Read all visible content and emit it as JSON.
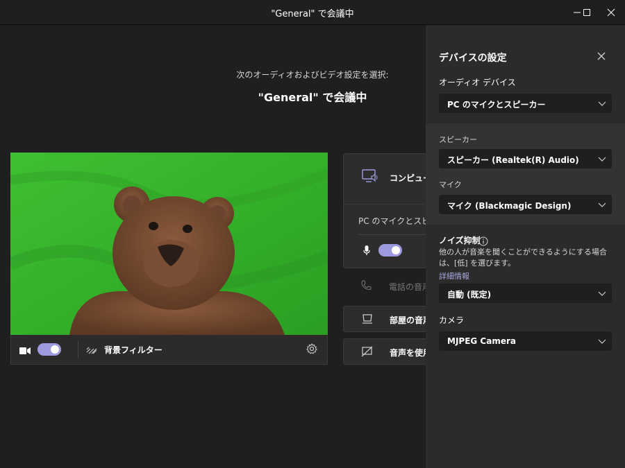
{
  "window": {
    "title": "\"General\" で会議中"
  },
  "prejoin": {
    "subtitle": "次のオーディオおよびビデオ設定を選択:",
    "meeting_title": "\"General\" で会議中",
    "video_bar": {
      "camera_on": true,
      "background_filter_label": "背景フィルター"
    },
    "audio_options": {
      "computer_audio_label": "コンピュータ",
      "computer_audio_device": "PC のマイクとスピーカー",
      "mic_on": true,
      "phone_audio_label": "電話の音声",
      "room_audio_label": "部屋の音声",
      "no_audio_label": "音声を使用"
    }
  },
  "device_settings": {
    "header": "デバイスの設定",
    "audio_device_label": "オーディオ デバイス",
    "audio_device_value": "PC のマイクとスピーカー",
    "speaker_label": "スピーカー",
    "speaker_value": "スピーカー (Realtek(R) Audio)",
    "mic_label": "マイク",
    "mic_value": "マイク (Blackmagic Design)",
    "noise_label": "ノイズ抑制",
    "noise_description": "他の人が音楽を聞くことができるようにする場合は、[低] を選びます。",
    "noise_link": "詳細情報",
    "noise_value": "自動 (既定)",
    "camera_label": "カメラ",
    "camera_value": "MJPEG Camera"
  },
  "colors": {
    "accent": "#9d9bde",
    "link": "#a6a7dc",
    "background": "#1f1f1f",
    "panel": "#2b2b2b",
    "greenscreen": "#35b32a"
  }
}
